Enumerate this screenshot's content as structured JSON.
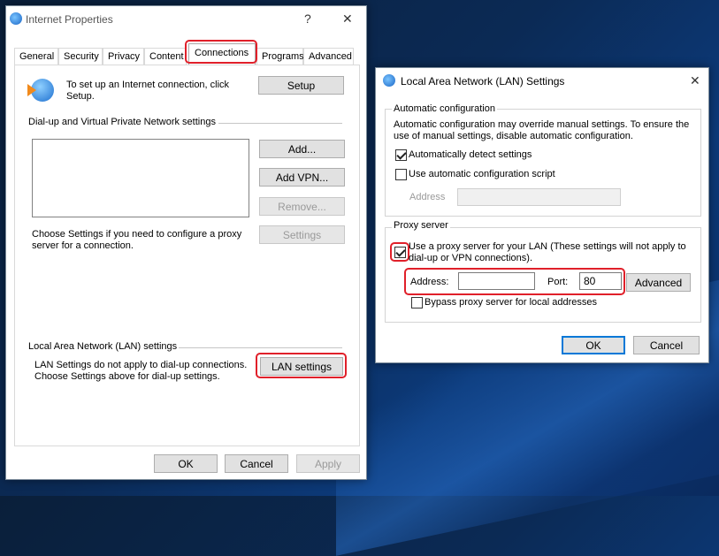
{
  "internet_properties": {
    "title": "Internet Properties",
    "help_glyph": "?",
    "close_glyph": "✕",
    "tabs": [
      "General",
      "Security",
      "Privacy",
      "Content",
      "Connections",
      "Programs",
      "Advanced"
    ],
    "setup_text": "To set up an Internet connection, click Setup.",
    "setup_button": "Setup",
    "dialup_header": "Dial-up and Virtual Private Network settings",
    "add_button": "Add...",
    "add_vpn_button": "Add VPN...",
    "remove_button": "Remove...",
    "settings_button": "Settings",
    "choose_settings_text": "Choose Settings if you need to configure a proxy server for a connection.",
    "lan_header": "Local Area Network (LAN) settings",
    "lan_text": "LAN Settings do not apply to dial-up connections. Choose Settings above for dial-up settings.",
    "lan_settings_button": "LAN settings",
    "ok_button": "OK",
    "cancel_button": "Cancel",
    "apply_button": "Apply"
  },
  "lan_dialog": {
    "title": "Local Area Network (LAN) Settings",
    "close_glyph": "✕",
    "auto_config_header": "Automatic configuration",
    "auto_config_text": "Automatic configuration may override manual settings.  To ensure the use of manual settings, disable automatic configuration.",
    "auto_detect_label": "Automatically detect settings",
    "auto_detect_checked": true,
    "use_script_label": "Use automatic configuration script",
    "use_script_checked": false,
    "script_address_label": "Address",
    "script_address_value": "",
    "proxy_header": "Proxy server",
    "use_proxy_label": "Use a proxy server for your LAN (These settings will not apply to dial-up or VPN connections).",
    "use_proxy_checked": true,
    "proxy_address_label": "Address:",
    "proxy_address_value": "",
    "port_label": "Port:",
    "port_value": "80",
    "advanced_button": "Advanced",
    "bypass_label": "Bypass proxy server for local addresses",
    "bypass_checked": false,
    "ok_button": "OK",
    "cancel_button": "Cancel"
  },
  "colors": {
    "highlight": "#e0202a",
    "accent": "#0078d7"
  }
}
